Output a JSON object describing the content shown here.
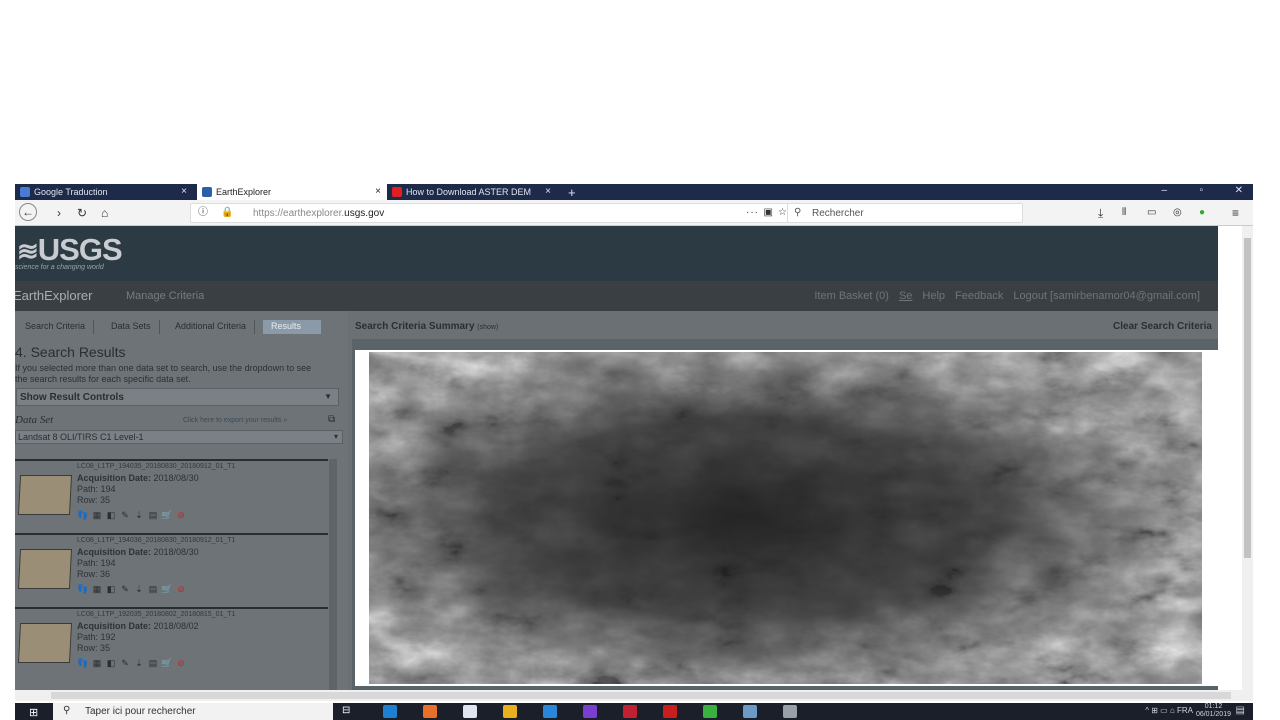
{
  "browser": {
    "tabs": [
      {
        "label": "Google Traduction",
        "color": "#4a7bd4"
      },
      {
        "label": "EarthExplorer",
        "color": "#2b5fa8",
        "active": true
      },
      {
        "label": "How to Download ASTER DEM",
        "color": "#e02020"
      }
    ],
    "new_tab": "+",
    "close": "×",
    "url_prefix": "https://earthexplorer.",
    "url_domain": "usgs.gov",
    "search_placeholder": "Rechercher",
    "more": "···"
  },
  "site": {
    "logo": "USGS",
    "tagline": "science for a changing world",
    "app_name": "EarthExplorer",
    "manage_criteria": "Manage Criteria",
    "menu_right": [
      "Item Basket (0)",
      "Se",
      "Help",
      "Feedback",
      "Logout [samirbenamor04@gmail.com]"
    ]
  },
  "left": {
    "tabs": [
      "Search Criteria",
      "Data Sets",
      "Additional Criteria",
      "Results"
    ],
    "title": "4. Search Results",
    "description": "If you selected more than one data set to search, use the dropdown to see the search results for each specific data set.",
    "show_controls": "Show Result Controls",
    "dataset_label": "Data Set",
    "export_link": "Click here to export your results »",
    "dataset_value": "Landsat 8 OLI/TIRS C1 Level-1",
    "results": [
      {
        "id": "LC08_L1TP_194035_20180830_20180912_01_T1",
        "date_label": "Acquisition Date:",
        "date": "2018/08/30",
        "path_label": "Path:",
        "path": "194",
        "row_label": "Row:",
        "row": "35"
      },
      {
        "id": "LC08_L1TP_194036_20180830_20180912_01_T1",
        "date_label": "Acquisition Date:",
        "date": "2018/08/30",
        "path_label": "Path:",
        "path": "194",
        "row_label": "Row:",
        "row": "36"
      },
      {
        "id": "LC08_L1TP_192035_20180802_20180815_01_T1",
        "date_label": "Acquisition Date:",
        "date": "2018/08/02",
        "path_label": "Path:",
        "path": "192",
        "row_label": "Row:",
        "row": "35"
      }
    ]
  },
  "right": {
    "summary": "Search Criteria Summary",
    "summary_note": "(show)",
    "clear": "Clear Search Criteria"
  },
  "taskbar": {
    "search_placeholder": "Taper ici pour rechercher",
    "lang": "FRA",
    "time": "01:12",
    "date": "06/01/2019"
  }
}
